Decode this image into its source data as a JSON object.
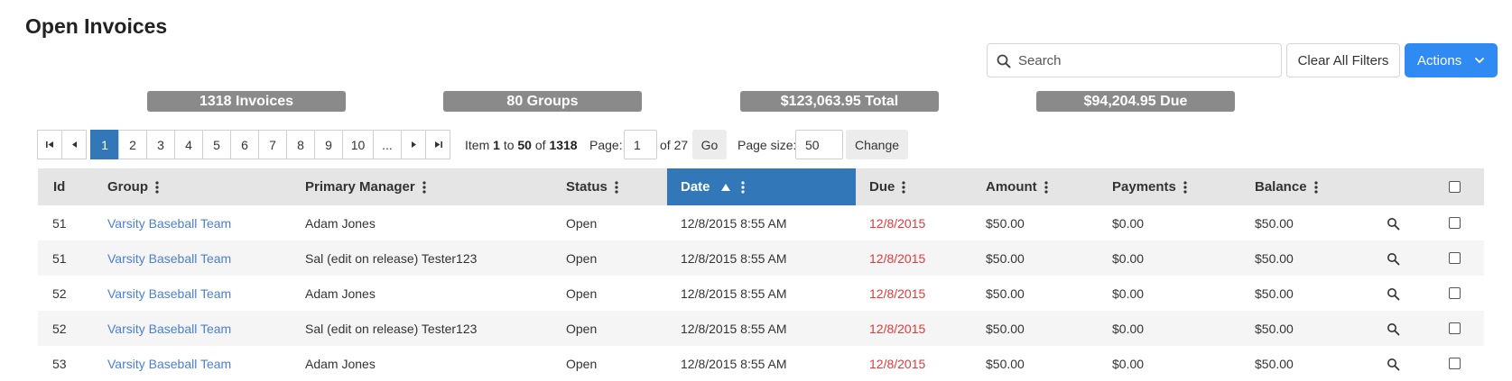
{
  "page": {
    "title": "Open Invoices"
  },
  "toolbar": {
    "search_placeholder": "Search",
    "search_value": "",
    "clear_filters_label": "Clear All Filters",
    "actions_label": "Actions"
  },
  "summary": {
    "invoices": "1318 Invoices",
    "groups": "80 Groups",
    "total": "$123,063.95 Total",
    "due": "$94,204.95 Due"
  },
  "pagination": {
    "pages": [
      "1",
      "2",
      "3",
      "4",
      "5",
      "6",
      "7",
      "8",
      "9",
      "10",
      "..."
    ],
    "current_page": "1",
    "item_label": "Item",
    "item_from": "1",
    "to_label": "to",
    "item_to": "50",
    "of_label": "of",
    "total_items": "1318",
    "page_label": "Page:",
    "page_value": "1",
    "of_pages_label": "of 27",
    "go_label": "Go",
    "page_size_label": "Page size:",
    "page_size_value": "50",
    "change_label": "Change"
  },
  "table": {
    "columns": {
      "id": "Id",
      "group": "Group",
      "primary_manager": "Primary Manager",
      "status": "Status",
      "date": "Date",
      "due": "Due",
      "amount": "Amount",
      "payments": "Payments",
      "balance": "Balance"
    },
    "sorted_column": "Date",
    "sort_direction": "ascending",
    "rows": [
      {
        "id": "51",
        "group": "Varsity Baseball Team",
        "manager": "Adam Jones",
        "status": "Open",
        "date": "12/8/2015 8:55 AM",
        "due": "12/8/2015",
        "amount": "$50.00",
        "payments": "$0.00",
        "balance": "$50.00"
      },
      {
        "id": "51",
        "group": "Varsity Baseball Team",
        "manager": "Sal (edit on release) Tester123",
        "status": "Open",
        "date": "12/8/2015 8:55 AM",
        "due": "12/8/2015",
        "amount": "$50.00",
        "payments": "$0.00",
        "balance": "$50.00"
      },
      {
        "id": "52",
        "group": "Varsity Baseball Team",
        "manager": "Adam Jones",
        "status": "Open",
        "date": "12/8/2015 8:55 AM",
        "due": "12/8/2015",
        "amount": "$50.00",
        "payments": "$0.00",
        "balance": "$50.00"
      },
      {
        "id": "52",
        "group": "Varsity Baseball Team",
        "manager": "Sal (edit on release) Tester123",
        "status": "Open",
        "date": "12/8/2015 8:55 AM",
        "due": "12/8/2015",
        "amount": "$50.00",
        "payments": "$0.00",
        "balance": "$50.00"
      },
      {
        "id": "53",
        "group": "Varsity Baseball Team",
        "manager": "Adam Jones",
        "status": "Open",
        "date": "12/8/2015 8:55 AM",
        "due": "12/8/2015",
        "amount": "$50.00",
        "payments": "$0.00",
        "balance": "$50.00"
      }
    ]
  },
  "colors": {
    "accent": "#2f8bf2",
    "active_header": "#3278b8",
    "link": "#4a7fd4",
    "due": "#e13a3a",
    "summary_badge": "#8a8a8a"
  },
  "icons": {
    "search": "search-icon",
    "actions_dropdown": "chevron-down-icon",
    "column_menu": "kebab-icon",
    "sort": "sort-up-icon",
    "row_view": "magnifier-icon"
  }
}
